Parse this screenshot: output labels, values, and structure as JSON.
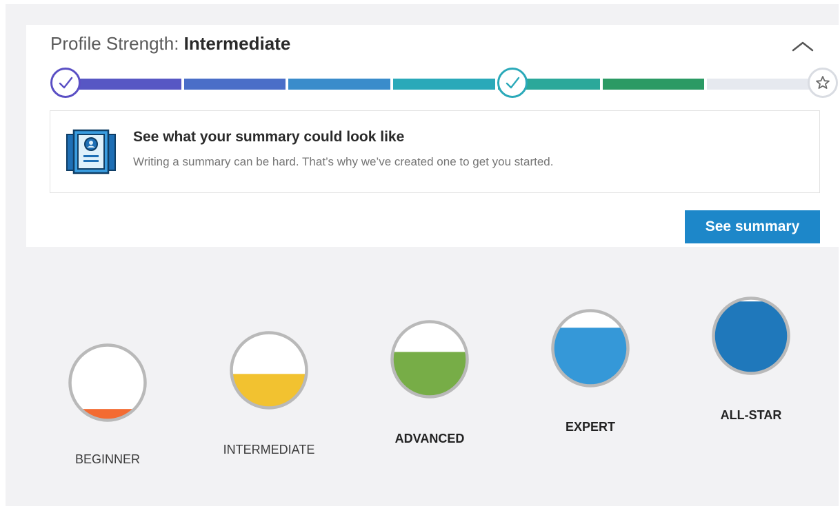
{
  "header": {
    "title_prefix": "Profile Strength:",
    "title_level": "Intermediate",
    "collapse_icon": "chevron-up-icon"
  },
  "meter": {
    "completed_segments": 6,
    "total_segments": 7,
    "node_icons": [
      "check-icon",
      "check-icon",
      "star-icon"
    ],
    "colors": [
      "#5757c4",
      "#4a6ec8",
      "#3a8ccb",
      "#2aa9b9",
      "#2ba89a",
      "#2b9a64",
      "#e6e9ef"
    ]
  },
  "summary_card": {
    "icon": "profile-document-icon",
    "title": "See what your summary could look like",
    "subtitle": "Writing a summary can be hard. That’s why we’ve created one to get you started."
  },
  "button": {
    "label": "See summary",
    "color": "#1d87c9"
  },
  "levels": [
    {
      "label": "BEGINNER",
      "fill": 0.14,
      "color": "#f36b32"
    },
    {
      "label": "INTERMEDIATE",
      "fill": 0.45,
      "color": "#f2c230"
    },
    {
      "label": "ADVANCED",
      "fill": 0.6,
      "color": "#77ad47"
    },
    {
      "label": "EXPERT",
      "fill": 0.78,
      "color": "#3598d8"
    },
    {
      "label": "ALL-STAR",
      "fill": 0.97,
      "color": "#1f78bb"
    }
  ]
}
